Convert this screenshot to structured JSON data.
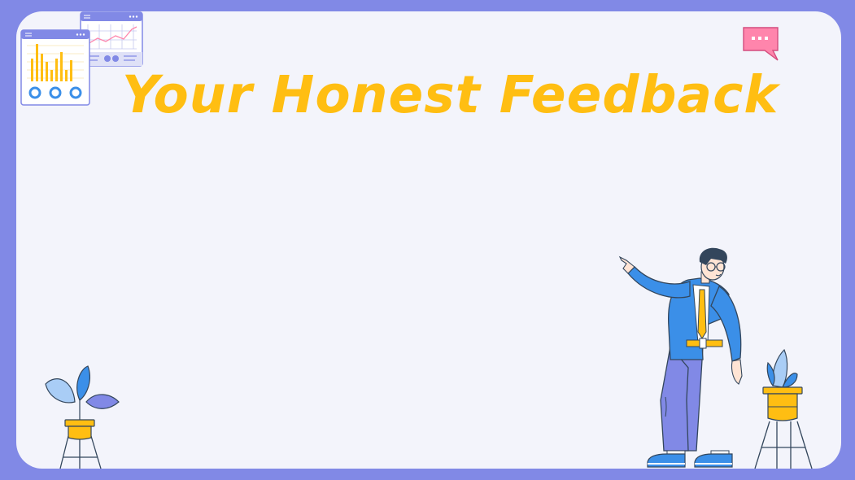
{
  "slide": {
    "title": "Your Honest Feedback"
  },
  "colors": {
    "frame": "#8189e6",
    "background": "#f3f4fb",
    "accent": "#ffbe12",
    "primary_blue": "#3b8fe8",
    "pants_purple": "#8189e6",
    "bubble_pink": "#ff85ac"
  },
  "decorations": {
    "chart_window_icon": "bar-chart-window-icon",
    "line_window_icon": "line-chart-window-icon",
    "chat_bubble_icon": "chat-bubble-icon",
    "character": "pointing-man-illustration",
    "plants": [
      "potted-plant-left",
      "potted-plant-right"
    ]
  }
}
